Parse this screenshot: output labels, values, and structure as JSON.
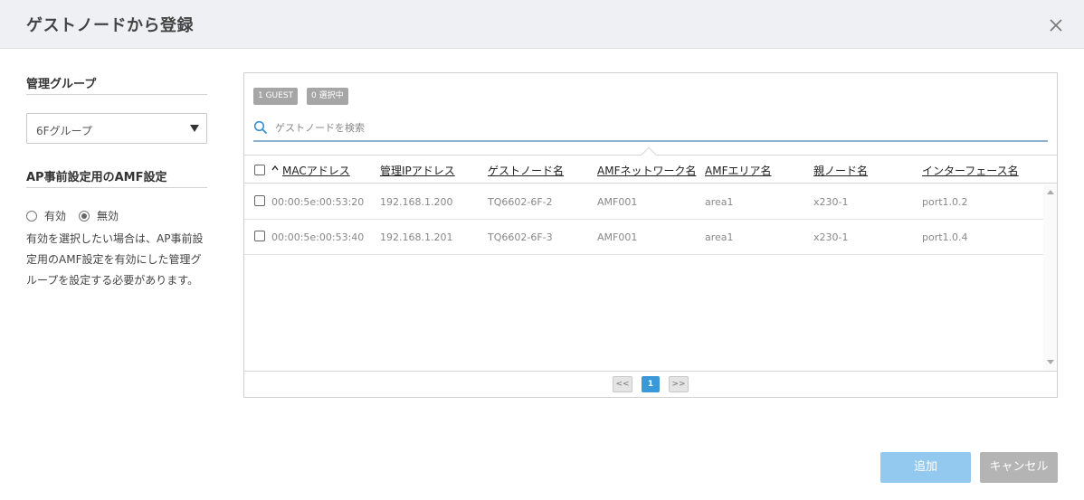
{
  "dialog": {
    "title": "ゲストノードから登録"
  },
  "left": {
    "group_title": "管理グループ",
    "group_select": {
      "value": "6Fグループ"
    },
    "amf_title": "AP事前設定用のAMF設定",
    "radio_enable": "有効",
    "radio_disable": "無効",
    "selected_radio": "無効",
    "note": "有効を選択したい場合は、AP事前設定用のAMF設定を有効にした管理グループを設定する必要があります。"
  },
  "panel": {
    "badges": [
      "1 GUEST",
      "0 選択中"
    ],
    "search_placeholder": "ゲストノードを検索",
    "columns": [
      "MACアドレス",
      "管理IPアドレス",
      "ゲストノード名",
      "AMFネットワーク名",
      "AMFエリア名",
      "親ノード名",
      "インターフェース名"
    ],
    "rows": [
      [
        "00:00:5e:00:53:20",
        "192.168.1.200",
        "TQ6602-6F-2",
        "AMF001",
        "area1",
        "x230-1",
        "port1.0.2"
      ],
      [
        "00:00:5e:00:53:40",
        "192.168.1.201",
        "TQ6602-6F-3",
        "AMF001",
        "area1",
        "x230-1",
        "port1.0.4"
      ]
    ],
    "pager": {
      "prev": "<<",
      "current": "1",
      "next": ">>"
    }
  },
  "footer": {
    "add": "追加",
    "cancel": "キャンセル"
  },
  "colors": {
    "accent": "#3a9ad9",
    "add_button": "#93c9ee",
    "cancel_button": "#b4b4b4",
    "header_bg": "#eef0f4"
  },
  "icons": {
    "close": "close-icon",
    "search": "search-icon",
    "sort": "sort-asc-icon",
    "dropdown": "caret-down-icon"
  }
}
